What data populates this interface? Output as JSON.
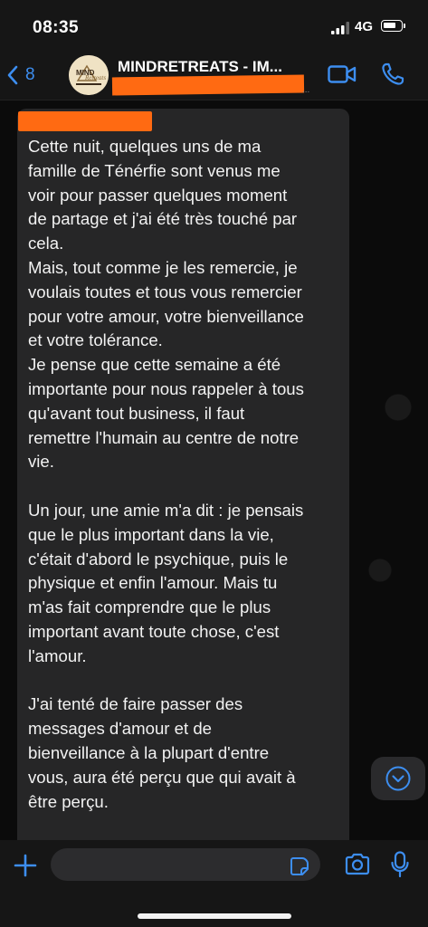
{
  "status_bar": {
    "time": "08:35",
    "network": "4G"
  },
  "header": {
    "back_count": "8",
    "chat_title": "MINDRETREATS - IM...",
    "avatar_text": "MIND Retreats"
  },
  "message": {
    "text": "Cette nuit, quelques uns de ma\nfamille de Ténérfie sont venus me\nvoir pour passer quelques moment\nde partage et j'ai été très touché par\ncela.\nMais, tout comme je les remercie, je\nvoulais toutes et tous vous remercier\npour votre amour, votre bienveillance\net votre tolérance.\nJe pense que cette semaine a été\nimportante pour nous rappeler à tous\nqu'avant tout business, il faut\nremettre l'humain au centre de notre\nvie.\n\nUn jour, une amie m'a dit : je pensais\nque le plus important dans la vie,\nc'était d'abord le psychique, puis le\nphysique et enfin l'amour. Mais tu\nm'as fait comprendre que le plus\nimportant avant toute chose, c'est\nl'amour.\n\nJ'ai tenté de faire passer des\nmessages d'amour et de\nbienveillance à la plupart d'entre\nvous, aura été perçu que qui avait à\nêtre perçu."
  },
  "colors": {
    "accent": "#3d8ef0",
    "redaction": "#ff6a12",
    "bubble": "#262627",
    "background": "#0b0b0b"
  },
  "icons": [
    "chevron-left-icon",
    "video-call-icon",
    "phone-icon",
    "chevron-down-icon",
    "plus-icon",
    "sticker-icon",
    "camera-icon",
    "microphone-icon"
  ]
}
